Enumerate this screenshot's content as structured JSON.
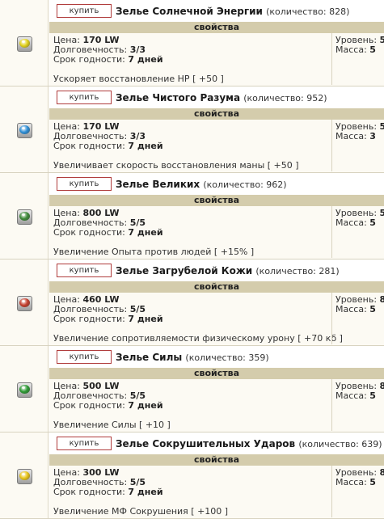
{
  "labels": {
    "buy": "купить",
    "properties": "свойства",
    "price": "Цена:",
    "durability": "Долговечность:",
    "shelf_life": "Срок годности:",
    "level": "Уровень:",
    "mass": "Масса:"
  },
  "items": [
    {
      "name": "Зелье Солнечной Энергии",
      "quantity": "(количество: 828)",
      "price": "170 LW",
      "durability": "3/3",
      "shelf_life": "7 дней",
      "level": "5",
      "mass": "5",
      "description": "Ускоряет восстановление HP [ +50 ]",
      "icon": "yellow-potion-icon",
      "color": "#e2d21c"
    },
    {
      "name": "Зелье Чистого Разума",
      "quantity": "(количество: 952)",
      "price": "170 LW",
      "durability": "3/3",
      "shelf_life": "7 дней",
      "level": "5",
      "mass": "3",
      "description": "Увеличивает скорость восстановления маны [ +50 ]",
      "icon": "blue-potion-icon",
      "color": "#2f8fd6"
    },
    {
      "name": "Зелье Великих",
      "quantity": "(количество: 962)",
      "price": "800 LW",
      "durability": "5/5",
      "shelf_life": "7 дней",
      "level": "5",
      "mass": "5",
      "description": "Увеличение Опыта против людей [ +15% ]",
      "icon": "green-flask-potion-icon",
      "color": "#3f8a3a"
    },
    {
      "name": "Зелье Загрубелой Кожи",
      "quantity": "(количество: 281)",
      "price": "460 LW",
      "durability": "5/5",
      "shelf_life": "7 дней",
      "level": "8",
      "mass": "5",
      "description": "Увеличение сопротивляемости физическому урону [ +70 кб ]",
      "icon": "red-green-potion-icon",
      "color": "#c4402e"
    },
    {
      "name": "Зелье Силы",
      "quantity": "(количество: 359)",
      "price": "500 LW",
      "durability": "5/5",
      "shelf_life": "7 дней",
      "level": "8",
      "mass": "5",
      "description": "Увеличение Силы [ +10 ]",
      "icon": "green-potion-icon",
      "color": "#2d9a34"
    },
    {
      "name": "Зелье Сокрушительных Ударов",
      "quantity": "(количество: 639)",
      "price": "300 LW",
      "durability": "5/5",
      "shelf_life": "7 дней",
      "level": "8",
      "mass": "5",
      "description": "Увеличение МФ Сокрушения [ +100 ]",
      "icon": "yellow-orange-potion-icon",
      "color": "#e8c51a"
    }
  ]
}
